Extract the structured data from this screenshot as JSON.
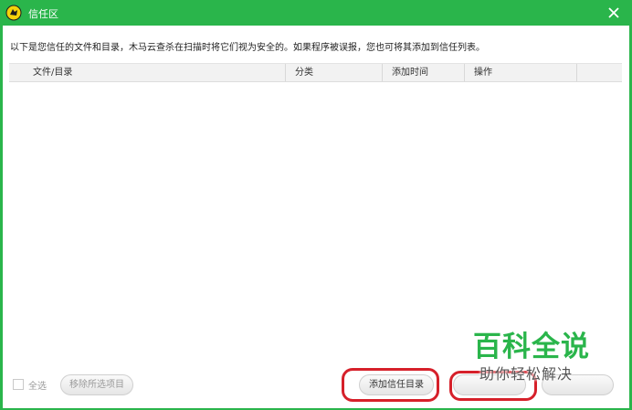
{
  "window": {
    "title": "信任区",
    "icon": "trojan-horse-logo-icon",
    "close_icon": "close-icon",
    "accent_color": "#2ab54b"
  },
  "intro_text": "以下是您信任的文件和目录，木马云查杀在扫描时将它们视为安全的。如果程序被误报，您也可将其添加到信任列表。",
  "table": {
    "columns": [
      "文件/目录",
      "分类",
      "添加时间",
      "操作"
    ],
    "rows": []
  },
  "footer": {
    "select_all_label": "全选",
    "remove_selected_label": "移除所选项目",
    "add_trust_dir_label": "添加信任目录",
    "add_trust_file_label": "",
    "close_label": ""
  },
  "annotation": {
    "highlight_color": "#d6202a"
  },
  "watermark": {
    "main": "百科全说",
    "sub": "助你轻松解决"
  }
}
